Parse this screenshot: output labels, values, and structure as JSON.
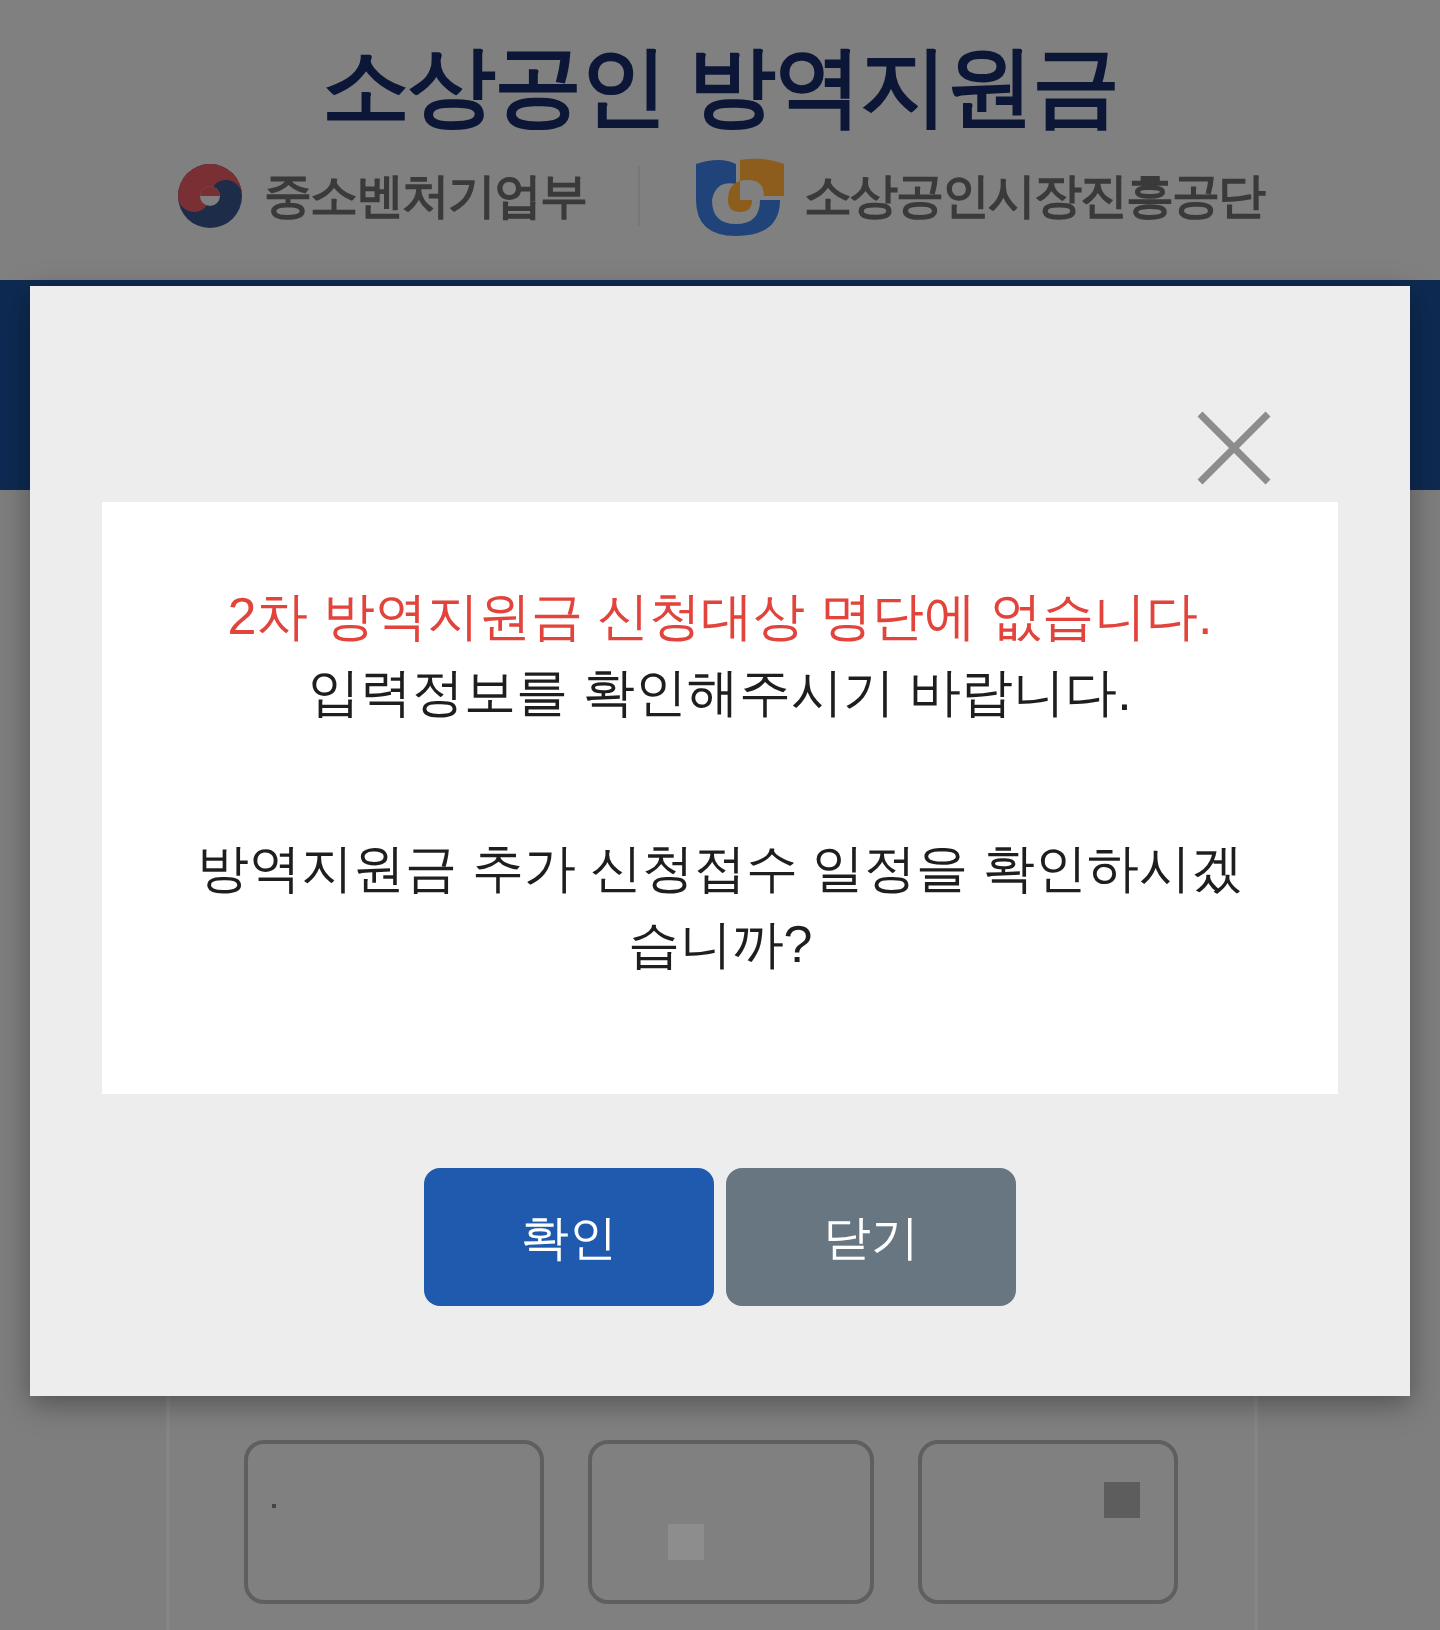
{
  "header": {
    "title": "소상공인 방역지원금",
    "agencies": [
      {
        "name": "중소벤처기업부",
        "kind": "ministry"
      },
      {
        "name": "소상공인시장진흥공단",
        "kind": "agency"
      }
    ]
  },
  "dialog": {
    "message": [
      {
        "text": "2차 방역지원금 신청대상 명단에 없습니다.",
        "kind": "alert"
      },
      {
        "text": "입력정보를 확인해주시기 바랍니다.",
        "kind": "normal"
      },
      {
        "text": "방역지원금 추가 신청접수 일정을 확인하시겠습니까?",
        "kind": "question"
      }
    ],
    "buttons": [
      {
        "label": "확인",
        "kind": "primary"
      },
      {
        "label": "닫기",
        "kind": "secondary"
      }
    ]
  }
}
